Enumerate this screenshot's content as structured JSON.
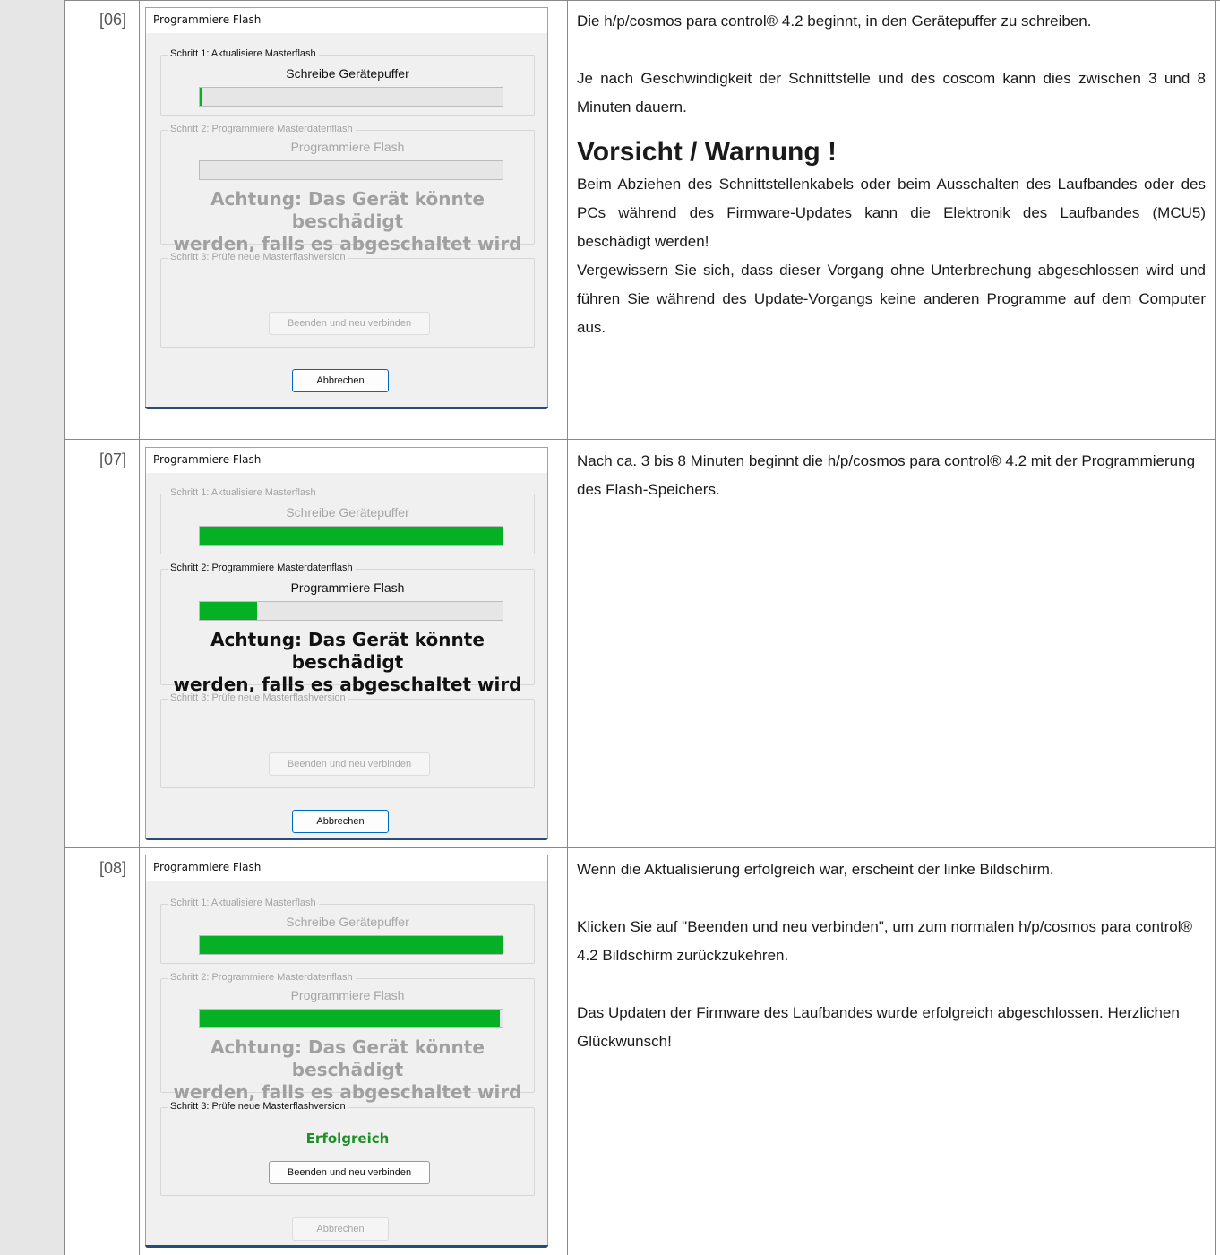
{
  "rows": [
    {
      "step": "[06]",
      "dialog": {
        "title": "Programmiere Flash",
        "step1": {
          "label": "Schritt 1: Aktualisiere Masterflash",
          "caption": "Schreibe Gerätepuffer",
          "progress": 0.01
        },
        "step2": {
          "label": "Schritt 2: Programmiere Masterdatenflash",
          "caption": "Programmiere Flash",
          "progress": 0,
          "warning_line1": "Achtung: Das Gerät könnte beschädigt",
          "warning_line2": "werden, falls es abgeschaltet wird"
        },
        "step3": {
          "label": "Schritt 3: Prüfe neue Masterflashversion",
          "status": "",
          "button": "Beenden und neu verbinden"
        },
        "cancel": "Abbrechen"
      },
      "text": {
        "p1": "Die h/p/cosmos para control® 4.2 beginnt, in den Gerätepuffer zu schreiben.",
        "p2": "Je nach Geschwindigkeit der Schnittstelle und des coscom kann dies zwischen 3 und 8 Minuten dauern.",
        "warning_title": "Vorsicht / Warnung !",
        "p3": "Beim Abziehen des Schnittstellenkabels oder beim Ausschalten des Laufbandes oder des PCs während des Firmware-Updates kann die Elektronik des Laufbandes (MCU5) beschädigt werden!",
        "p4": "Vergewissern Sie sich, dass dieser Vorgang ohne Unterbrechung abgeschlossen wird und führen Sie während des Update-Vorgangs keine anderen Programme auf dem Computer aus."
      }
    },
    {
      "step": "[07]",
      "dialog": {
        "title": "Programmiere Flash",
        "step1": {
          "label": "Schritt 1: Aktualisiere Masterflash",
          "caption": "Schreibe Gerätepuffer",
          "progress": 1.0
        },
        "step2": {
          "label": "Schritt 2: Programmiere Masterdatenflash",
          "caption": "Programmiere Flash",
          "progress": 0.19,
          "warning_line1": "Achtung: Das Gerät könnte beschädigt",
          "warning_line2": "werden, falls es abgeschaltet wird"
        },
        "step3": {
          "label": "Schritt 3: Prüfe neue Masterflashversion",
          "status": "",
          "button": "Beenden und neu verbinden"
        },
        "cancel": "Abbrechen"
      },
      "text": {
        "p1": "Nach ca. 3 bis 8 Minuten beginnt die h/p/cosmos para control® 4.2 mit der Programmierung des Flash-Speichers."
      }
    },
    {
      "step": "[08]",
      "dialog": {
        "title": "Programmiere Flash",
        "step1": {
          "label": "Schritt 1: Aktualisiere Masterflash",
          "caption": "Schreibe Gerätepuffer",
          "progress": 1.0
        },
        "step2": {
          "label": "Schritt 2: Programmiere Masterdatenflash",
          "caption": "Programmiere Flash",
          "progress": 0.99,
          "warning_line1": "Achtung: Das Gerät könnte beschädigt",
          "warning_line2": "werden, falls es abgeschaltet wird"
        },
        "step3": {
          "label": "Schritt 3: Prüfe neue Masterflashversion",
          "status": "Erfolgreich",
          "button": "Beenden und neu verbinden"
        },
        "cancel": "Abbrechen"
      },
      "text": {
        "p1": "Wenn die Aktualisierung erfolgreich war, erscheint der linke Bildschirm.",
        "p2": "Klicken Sie auf \"Beenden und neu verbinden\", um zum normalen h/p/cosmos para control® 4.2 Bildschirm zurückzukehren.",
        "p3": "Das Updaten der Firmware des Laufbandes wurde erfolgreich abgeschlossen. Herzlichen Glückwunsch!"
      }
    }
  ],
  "colors": {
    "progress": "#06b025",
    "success": "#1f8f2a",
    "accent": "#0067c0"
  }
}
